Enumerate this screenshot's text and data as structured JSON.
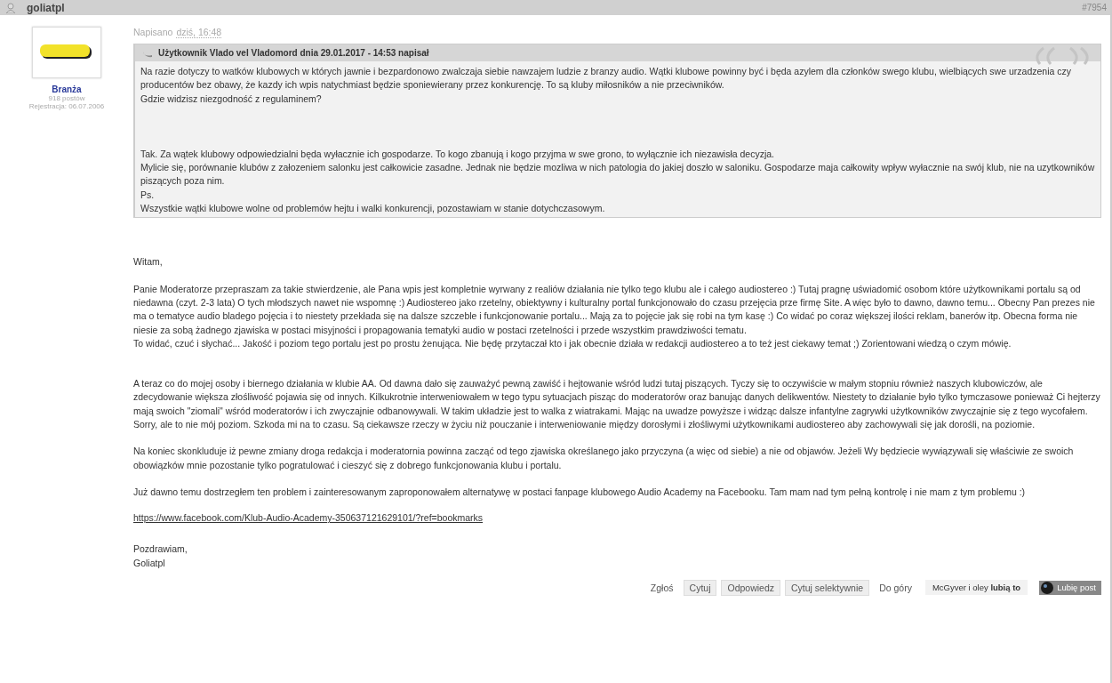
{
  "post_header": {
    "author": "goliatpl",
    "post_number": "#7954"
  },
  "author_panel": {
    "group": "Branża",
    "posts": "918 postów",
    "registered": "Rejestracja: 06.07.2006"
  },
  "posted": {
    "label": "Napisano",
    "time": "dziś, 16:48"
  },
  "quote": {
    "title": "Użytkownik Vlado vel Vladomord dnia 29.01.2017 - 14:53 napisał",
    "paragraphs": [
      [
        "Na razie dotyczy to watków klubowych w których jawnie i bezpardonowo zwalczaja siebie nawzajem ludzie z branzy audio. Wątki klubowe powinny być i będa azylem dla członków swego klubu, wielbiących swe urzadzenia czy producentów bez obawy, że kazdy ich wpis natychmiast będzie sponiewierany przez konkurencję. To są kluby miłosników a nie przeciwników.",
        "Gdzie widzisz niezgodność z regulaminem?"
      ],
      [
        "Tak. Za wątek klubowy odpowiedzialni będa wyłacznie ich gospodarze. To kogo zbanują i kogo przyjma w swe grono, to wyłącznie ich niezawisła decyzja.",
        "Mylicie się, porównanie klubów z załozeniem salonku jest całkowicie zasadne. Jednak nie będzie mozliwa w nich patologia do jakiej doszło w saloniku. Gospodarze maja całkowity wpływ wyłacznie na swój klub, nie na uzytkowników piszących poza nim.",
        "Ps.",
        "Wszystkie wątki klubowe wolne od problemów hejtu i walki konkurencji, pozostawiam w stanie dotychczasowym."
      ]
    ]
  },
  "body": {
    "paragraphs": [
      [
        "Witam,"
      ],
      [
        "Panie Moderatorze przepraszam za takie stwierdzenie, ale Pana wpis jest kompletnie wyrwany z realiów działania nie tylko tego klubu ale i całego audiostereo :) Tutaj pragnę uświadomić osobom które użytkownikami portalu są od niedawna (czyt. 2-3 lata) O tych młodszych nawet nie wspomnę :) Audiostereo jako rzetelny, obiektywny i kulturalny portal funkcjonowało do czasu przejęcia prze firmę Site. A więc było to dawno, dawno temu... Obecny Pan prezes nie ma o tematyce audio bladego pojęcia i to niestety przekłada się na dalsze szczeble i funkcjonowanie portalu... Mają za to pojęcie jak się robi na tym kasę :) Co widać po coraz większej ilości reklam, banerów itp. Obecna forma nie niesie za sobą żadnego zjawiska w postaci misyjności i propagowania tematyki audio w postaci rzetelności i przede wszystkim prawdziwości tematu.",
        "To widać, czuć i słychać... Jakość i poziom tego portalu jest po prostu żenująca. Nie będę przytaczał kto i jak obecnie działa w redakcji audiostereo a to też jest ciekawy temat ;) Zorientowani wiedzą o czym mówię."
      ],
      [
        "A teraz co do mojej osoby i biernego działania w klubie AA. Od dawna dało się zauważyć pewną zawiść i hejtowanie wśród ludzi tutaj piszących. Tyczy się to oczywiście w małym stopniu również naszych klubowiczów, ale zdecydowanie większa złośliwość pojawia się od innych. Kilkukrotnie interweniowałem w tego typu sytuacjach pisząc do moderatorów oraz banując danych delikwentów. Niestety to działanie było tylko tymczasowe ponieważ Ci hejterzy mają swoich \"ziomali\" wśród moderatorów i ich zwyczajnie odbanowywali. W takim układzie jest to walka z wiatrakami. Mając na uwadze powyższe i widząc dalsze infantylne zagrywki użytkowników zwyczajnie się z tego wycofałem. Sorry, ale to nie mój poziom. Szkoda mi na to czasu. Są ciekawsze rzeczy w życiu niż pouczanie i interweniowanie między dorosłymi i złośliwymi użytkownikami audiostereo aby zachowywali się jak dorośli, na poziomie."
      ],
      [
        "Na koniec skonkluduje iż pewne zmiany droga redakcja i moderatornia powinna zacząć od tego zjawiska określanego jako przyczyna (a więc od siebie) a nie od objawów. Jeżeli Wy będziecie wywiązywali się właściwie ze swoich obowiązków mnie pozostanie tylko pogratulować i cieszyć się z dobrego funkcjonowania klubu i portalu."
      ],
      [
        "Już dawno temu dostrzegłem ten problem i zainteresowanym zaproponowałem alternatywę w postaci fanpage klubowego Audio Academy na Facebooku. Tam mam nad tym pełną kontrolę i nie mam z tym problemu :)"
      ]
    ],
    "link": "https://www.facebook.com/Klub-Audio-Academy-350637121629101/?ref=bookmarks",
    "signoff": [
      "Pozdrawiam,",
      "Goliatpl"
    ]
  },
  "actions": {
    "report": "Zgłoś",
    "buttons": [
      "Cytuj",
      "Odpowiedz",
      "Cytuj selektywnie"
    ],
    "top": "Do góry",
    "likes": "McGyver i oley **lubią to**",
    "like_button": "Lubię post"
  }
}
